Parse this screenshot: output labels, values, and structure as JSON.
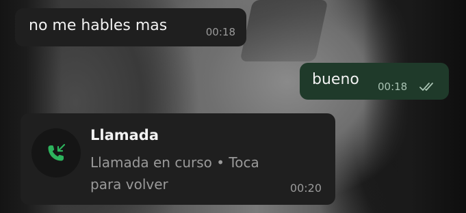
{
  "messages": {
    "incoming": {
      "text": "no me hables mas",
      "time": "00:18"
    },
    "outgoing": {
      "text": "bueno",
      "time": "00:18",
      "status_icon": "double-check-icon"
    },
    "call": {
      "title": "Llamada",
      "subtitle": "Llamada en curso • Toca para volver",
      "time": "00:20",
      "icon": "incoming-call-icon",
      "icon_color": "#2db35d"
    }
  },
  "colors": {
    "incoming_bubble": "#1f1f1f",
    "outgoing_bubble": "#1f3a2a"
  }
}
